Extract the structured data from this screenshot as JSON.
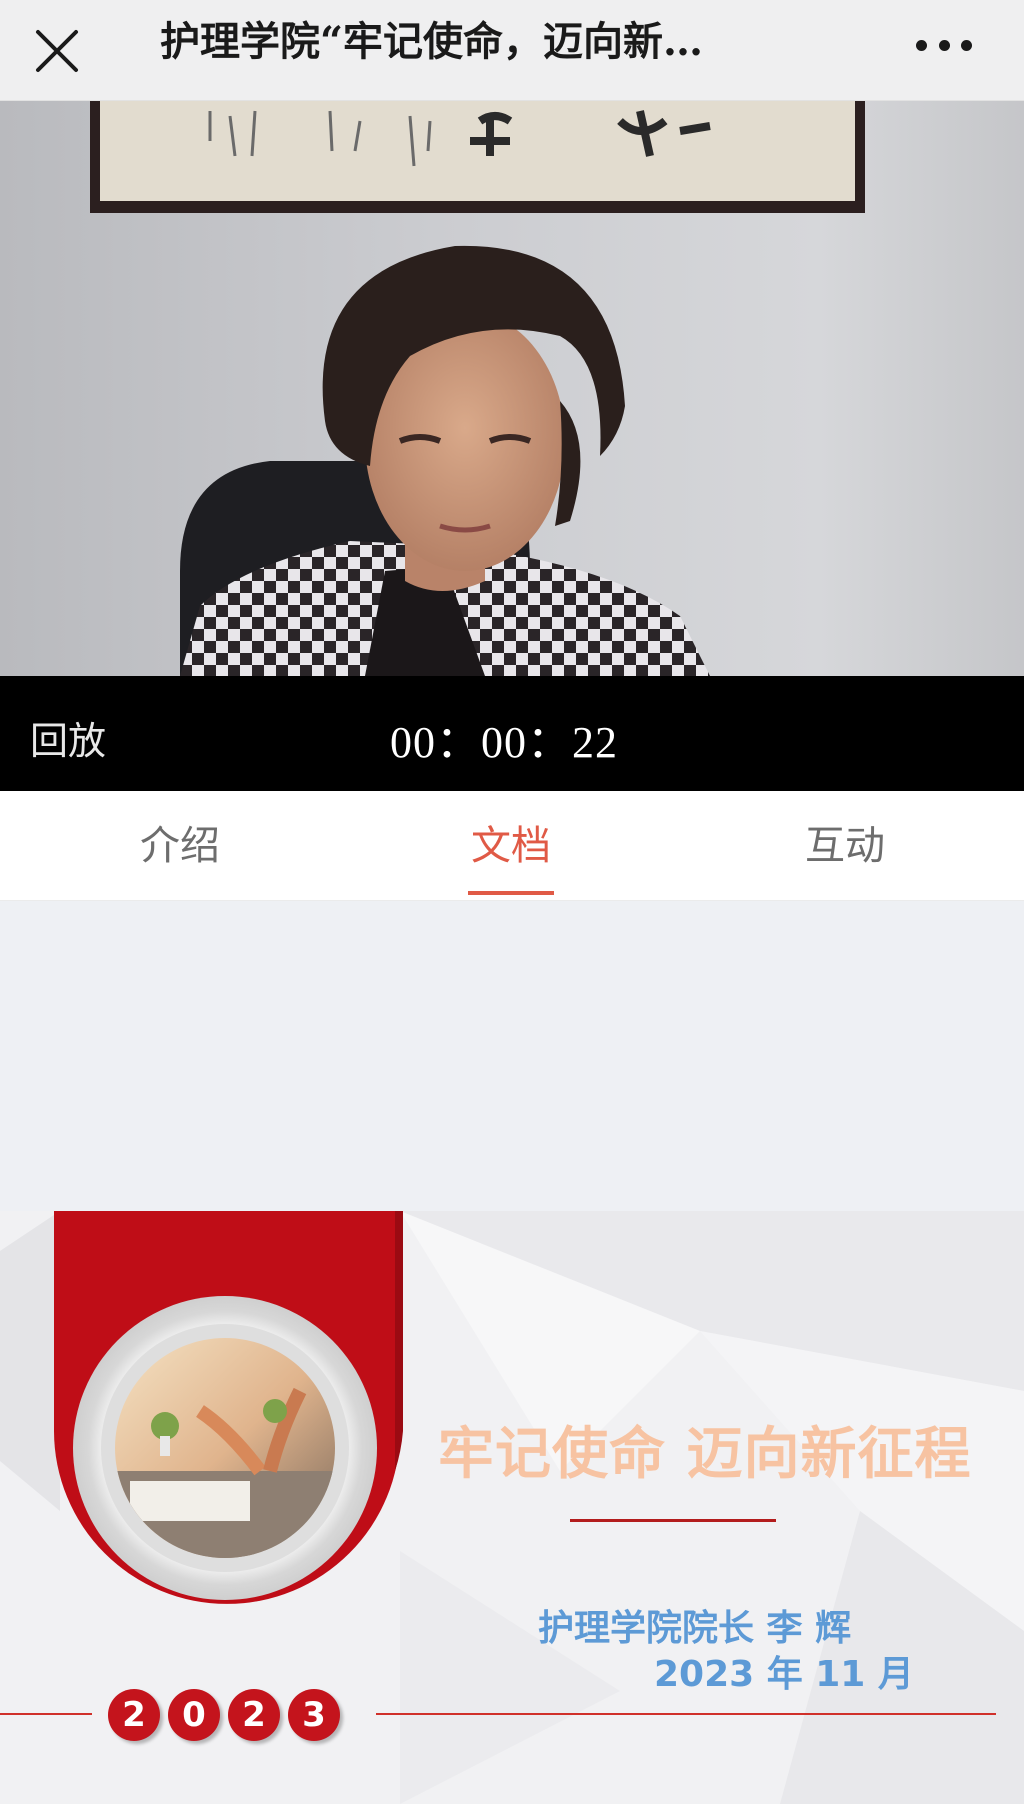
{
  "header": {
    "title": "护理学院“牢记使命，迈向新…",
    "close_icon": "close-icon",
    "more_icon": "more-icon"
  },
  "player": {
    "mode_label": "回放",
    "timecode": "00：00：22"
  },
  "tabs": [
    {
      "label": "介绍",
      "active": false
    },
    {
      "label": "文档",
      "active": true
    },
    {
      "label": "互动",
      "active": false
    }
  ],
  "document": {
    "slide_title": "牢记使命 迈向新征程",
    "author": "护理学院院长  李 辉",
    "date": "2023 年 11 月",
    "year_digits": [
      "2",
      "0",
      "2",
      "3"
    ]
  },
  "colors": {
    "accent": "#e05a46",
    "brand_red": "#c4141c",
    "title_peach": "#f7c3a2",
    "author_blue": "#5d9ad6"
  }
}
